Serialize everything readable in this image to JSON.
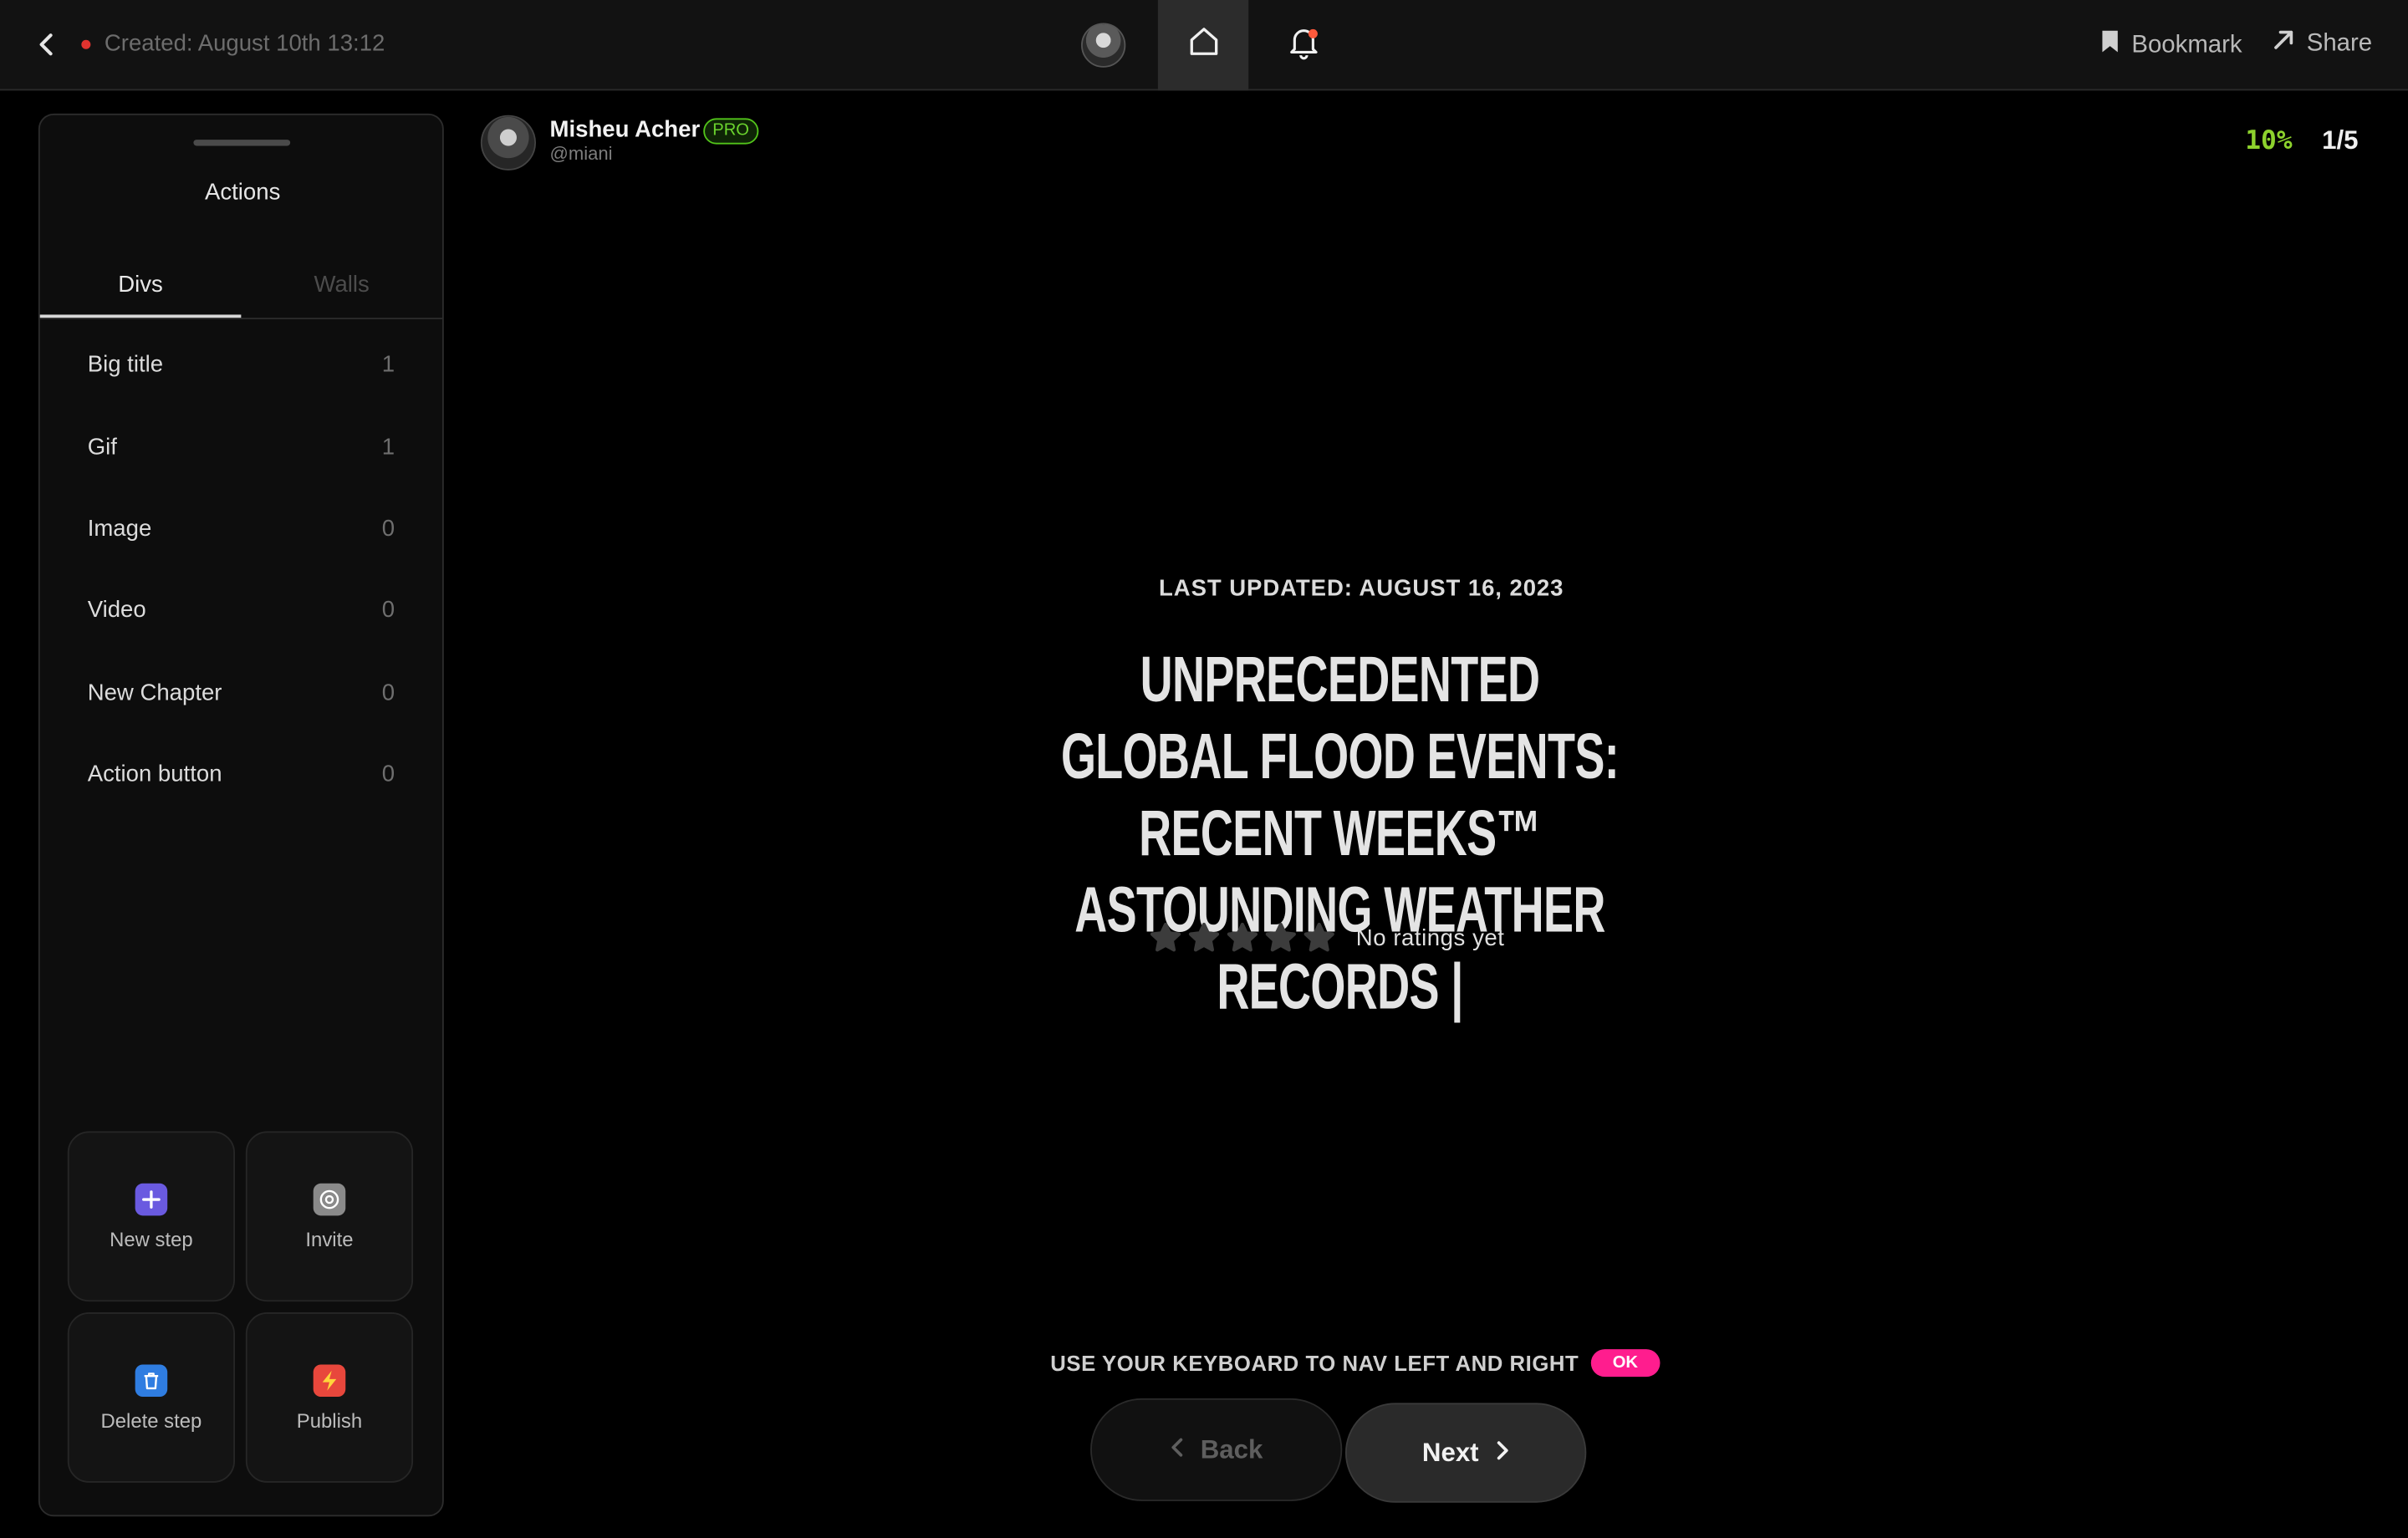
{
  "topbar": {
    "created": "Created: August 10th 13:12",
    "bookmark_label": "Bookmark",
    "share_label": "Share",
    "notification_dot_color": "#ff5a3c",
    "recording_dot_color": "#e0332f"
  },
  "author": {
    "name": "Misheu Acher",
    "badge": "PRO",
    "handle": "@miani"
  },
  "progress": {
    "percent": "10%",
    "step": "1/5"
  },
  "sidebar": {
    "title": "Actions",
    "tabs": [
      {
        "label": "Divs",
        "active": true
      },
      {
        "label": "Walls",
        "active": false
      }
    ],
    "items": [
      {
        "label": "Big title",
        "count": "1"
      },
      {
        "label": "Gif",
        "count": "1"
      },
      {
        "label": "Image",
        "count": "0"
      },
      {
        "label": "Video",
        "count": "0"
      },
      {
        "label": "New Chapter",
        "count": "0"
      },
      {
        "label": "Action button",
        "count": "0"
      }
    ],
    "actions": [
      {
        "label": "New step",
        "icon": "plus-icon",
        "color": "#6a5ae0"
      },
      {
        "label": "Invite",
        "icon": "invite-icon",
        "color": "#8a8a8a"
      },
      {
        "label": "Delete step",
        "icon": "trash-icon",
        "color": "#2f7de1"
      },
      {
        "label": "Publish",
        "icon": "bolt-icon",
        "color": "#e8473c"
      }
    ]
  },
  "content": {
    "updated": "LAST UPDATED: AUGUST 16, 2023",
    "headline": "UNPRECEDENTED GLOBAL FLOOD EVENTS: RECENT WEEKS™ ASTOUNDING WEATHER RECORDS |",
    "rating_text": "No ratings yet",
    "stars": 5,
    "rating": 0
  },
  "navigation": {
    "hint": "USE YOUR KEYBOARD TO NAV LEFT AND RIGHT",
    "ok": "OK",
    "back_label": "Back",
    "next_label": "Next"
  }
}
